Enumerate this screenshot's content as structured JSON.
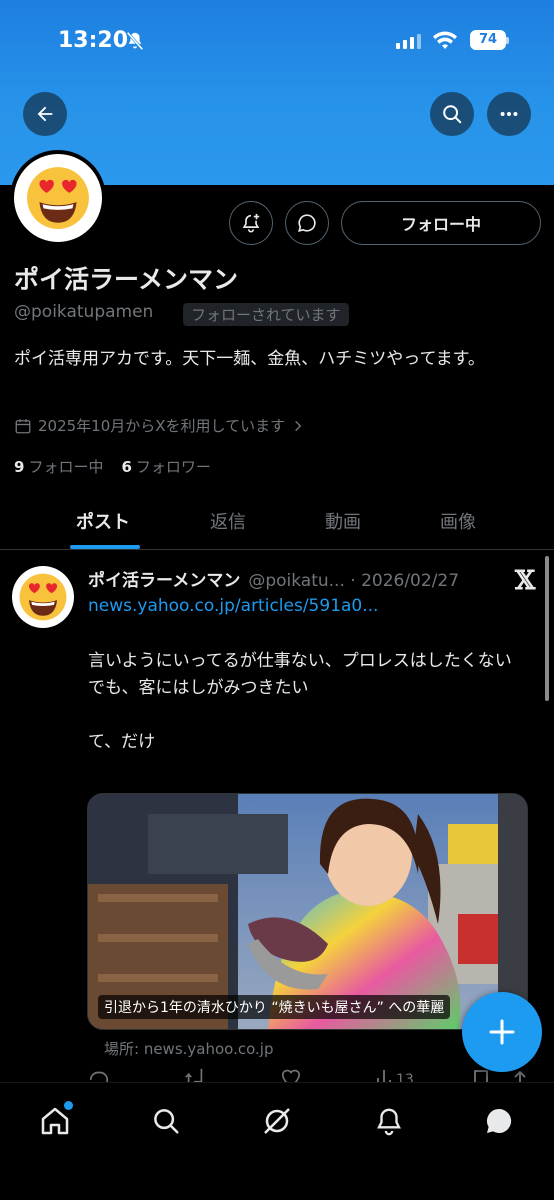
{
  "status_bar": {
    "time": "13:20",
    "battery": "74"
  },
  "header": {
    "back_icon": "back-arrow-icon",
    "search_icon": "search-icon",
    "more_icon": "more-icon"
  },
  "profile": {
    "avatar_emoji": "😍",
    "name": "ポイ活ラーメンマン",
    "handle": "@poikatupamen",
    "follows_you": "フォローされています",
    "bio": "ポイ活専用アカです。天下一麺、金魚、ハチミツやってます。",
    "joined": "2025年10月からXを利用しています",
    "following_count": "9",
    "following_label": "フォロー中",
    "followers_count": "6",
    "followers_label": "フォロワー",
    "follow_button": "フォロー中"
  },
  "tabs": [
    "ポスト",
    "返信",
    "動画",
    "画像"
  ],
  "post": {
    "author": "ポイ活ラーメンマン",
    "handle_date": "@poikatu... · 2026/02/27",
    "link": "news.yahoo.co.jp/articles/591a0...",
    "text": "言いようにいってるが仕事ない、プロレスはしたくない\nでも、客にはしがみつきたい\n\nて、だけ",
    "card_caption": "引退から1年の清水ひかり “焼きいも屋さん” への華麗",
    "card_source": "場所: news.yahoo.co.jp",
    "views": "13"
  },
  "colors": {
    "accent": "#1d9bf0",
    "banner": "#2794ea",
    "background": "#000000"
  }
}
